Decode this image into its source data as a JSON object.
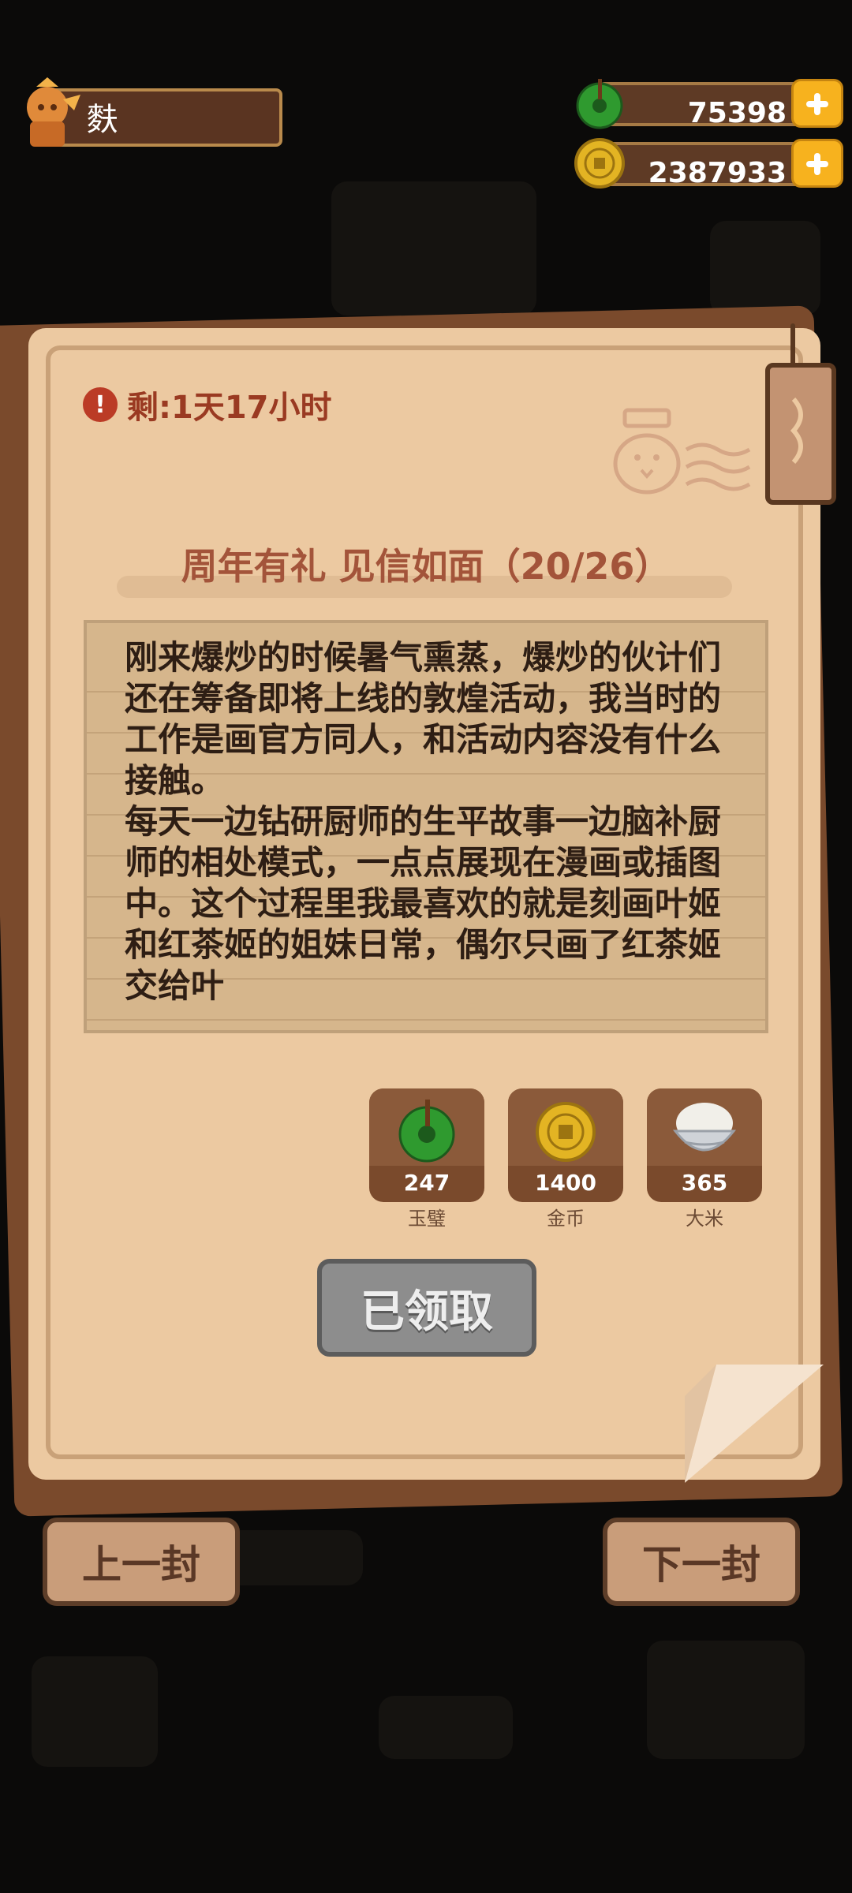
{
  "player": {
    "name": "麩"
  },
  "currencies": [
    {
      "icon": "jade-icon",
      "amount": "75398"
    },
    {
      "icon": "gold-coin-icon",
      "amount": "2387933"
    }
  ],
  "letter": {
    "timer": "剩:1天17小时",
    "title": "周年有礼 见信如面（20/26）",
    "body": "刚来爆炒的时候暑气熏蒸，爆炒的伙计们还在筹备即将上线的敦煌活动，我当时的工作是画官方同人，和活动内容没有什么接触。\n每天一边钻研厨师的生平故事一边脑补厨师的相处模式，一点点展现在漫画或插图中。这个过程里我最喜欢的就是刻画叶姬和红茶姬的姐妹日常，偶尔只画了红茶姬交给叶"
  },
  "rewards": [
    {
      "icon": "jade-icon",
      "count": "247",
      "label": "玉璧"
    },
    {
      "icon": "gold-coin-icon",
      "count": "1400",
      "label": "金币"
    },
    {
      "icon": "rice-bowl-icon",
      "count": "365",
      "label": "大米"
    }
  ],
  "claim_button": "已领取",
  "nav": {
    "prev": "上一封",
    "next": "下一封"
  },
  "colors": {
    "panel": "#ecc9a1",
    "title": "#a3543a",
    "plus": "#f7b21e"
  }
}
